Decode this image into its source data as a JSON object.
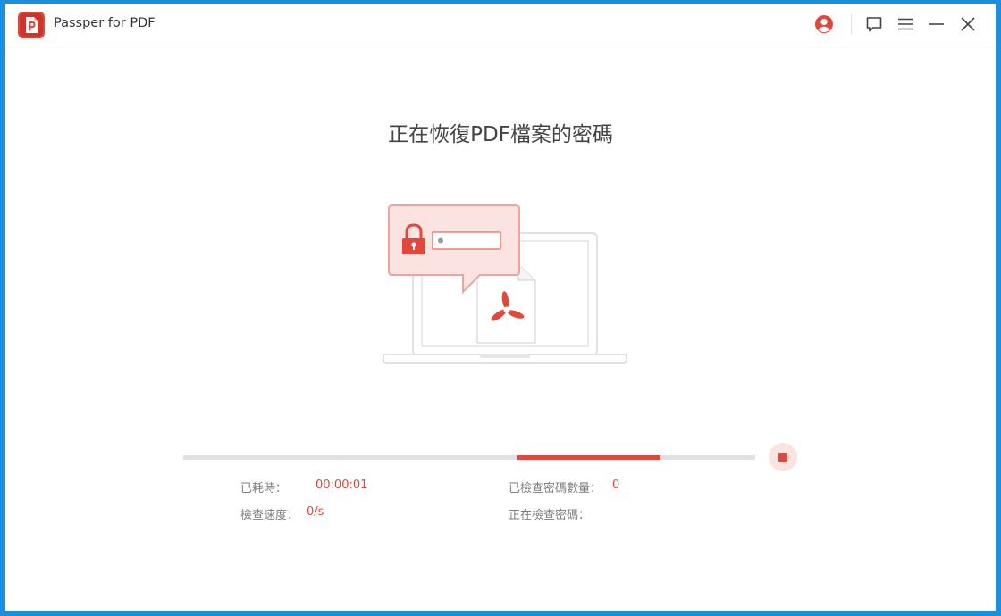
{
  "titlebar": {
    "app_title": "Passper for PDF",
    "icons": [
      "account-icon",
      "feedback-icon",
      "menu-icon",
      "minimize-icon",
      "close-icon"
    ]
  },
  "main": {
    "heading": "正在恢復PDF檔案的密碼"
  },
  "progress": {
    "value_percent": 25
  },
  "stats": {
    "elapsed_label": "已耗時：",
    "elapsed_value": "00:00:01",
    "checked_label": "已檢查密碼數量：",
    "checked_value": "0",
    "speed_label": "檢查速度：",
    "speed_value": "0/s",
    "current_label": "正在檢查密碼："
  },
  "colors": {
    "accent": "#e0483b",
    "accent_light": "#fbe3e1",
    "frame": "#1a8fe0",
    "track": "#e1e1e1"
  }
}
